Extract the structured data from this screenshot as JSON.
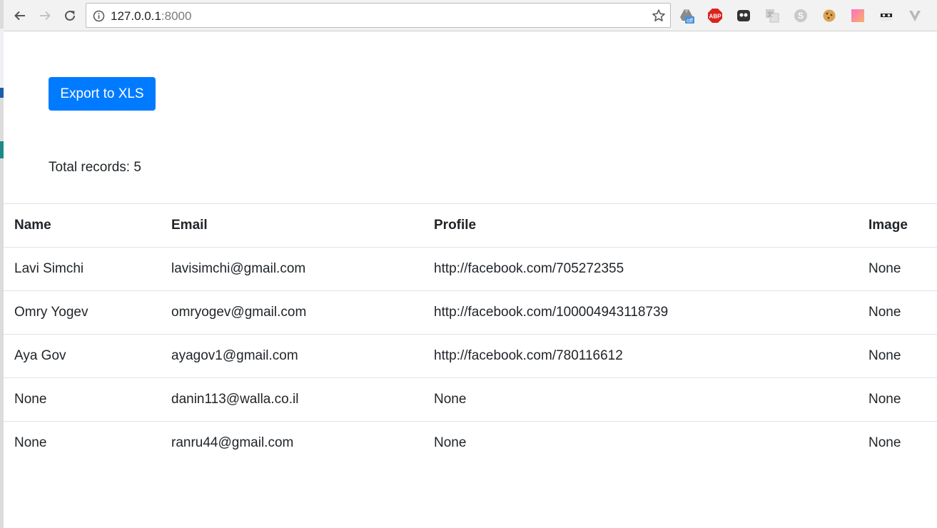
{
  "browser": {
    "url_host": "127.0.0.1",
    "url_port": ":8000",
    "extensions": [
      {
        "name": "google-drive-off-icon",
        "badge": "off"
      },
      {
        "name": "adblock-plus-icon",
        "label": "ABP"
      },
      {
        "name": "ghostery-icon"
      },
      {
        "name": "translate-icon"
      },
      {
        "name": "skype-icon"
      },
      {
        "name": "cookie-icon"
      },
      {
        "name": "gradient-extension-icon"
      },
      {
        "name": "incognito-mask-icon"
      },
      {
        "name": "vivaldi-v-icon"
      }
    ]
  },
  "page": {
    "export_label": "Export to XLS",
    "total_records": "Total records: 5",
    "colors": {
      "primary": "#007bff",
      "border": "#dee2e6",
      "text": "#212529"
    }
  },
  "table": {
    "headers": [
      "Name",
      "Email",
      "Profile",
      "Image"
    ],
    "rows": [
      [
        "Lavi Simchi",
        "lavisimchi@gmail.com",
        "http://facebook.com/705272355",
        "None"
      ],
      [
        "Omry Yogev",
        "omryogev@gmail.com",
        "http://facebook.com/100004943118739",
        "None"
      ],
      [
        "Aya Gov",
        "ayagov1@gmail.com",
        "http://facebook.com/780116612",
        "None"
      ],
      [
        "None",
        "danin113@walla.co.il",
        "None",
        "None"
      ],
      [
        "None",
        "ranru44@gmail.com",
        "None",
        "None"
      ]
    ]
  }
}
